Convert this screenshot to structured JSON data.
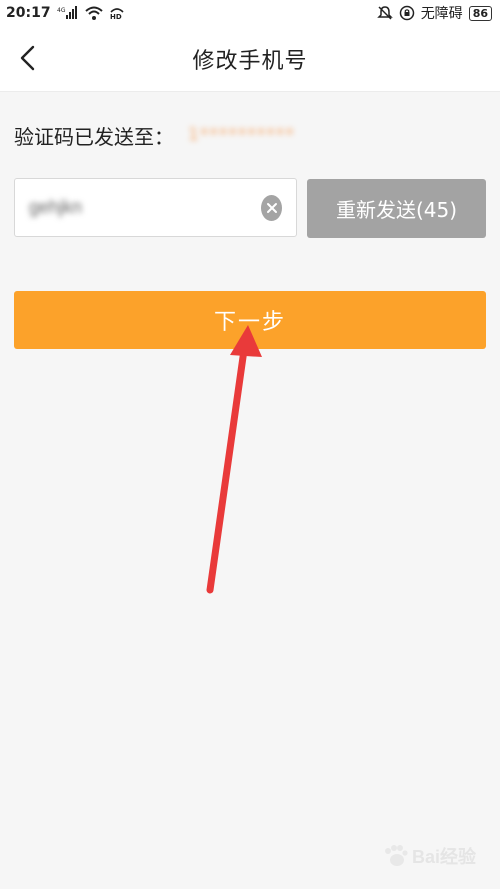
{
  "status_bar": {
    "time": "20:17",
    "network": "4G",
    "hd": "HD",
    "accessibility": "无障碍",
    "battery": "86"
  },
  "nav": {
    "title": "修改手机号",
    "back_icon": "chevron-left-icon"
  },
  "verification": {
    "sent_label": "验证码已发送至：",
    "phone_masked": "1**********"
  },
  "code_input": {
    "value": "gehjkn"
  },
  "resend_button": {
    "label": "重新发送(45)"
  },
  "next_button": {
    "label": "下一步"
  },
  "colors": {
    "accent": "#fca22a",
    "resend_bg": "#a3a3a3",
    "annotation": "#e93a3a"
  },
  "watermark": {
    "text": "Bai经验"
  }
}
